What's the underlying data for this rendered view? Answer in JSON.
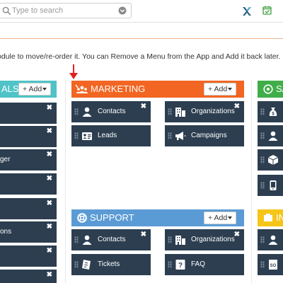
{
  "topbar": {
    "search_placeholder": "Type to search"
  },
  "instruction": "odule to move/re-order it. You can Remove a Menu from the App and Add it back later.",
  "add_label": "+ Add",
  "colors": {
    "tile_bg": "#2c3e50",
    "left_panel": "#4fc3c7",
    "marketing": "#f26522",
    "support": "#5b9bd5",
    "sales": "#3fae49",
    "inventory": "#f5c518"
  },
  "panels": {
    "left": {
      "title": "ALS",
      "tiles": [
        "",
        "",
        "ger",
        "",
        "",
        "ons",
        "",
        ""
      ]
    },
    "marketing": {
      "title": "MARKETING",
      "tiles": [
        {
          "label": "Contacts",
          "icon": "contacts-icon"
        },
        {
          "label": "Organizations",
          "icon": "organizations-icon"
        },
        {
          "label": "Leads",
          "icon": "leads-icon"
        },
        {
          "label": "Campaigns",
          "icon": "campaigns-icon"
        }
      ]
    },
    "support": {
      "title": "SUPPORT",
      "tiles": [
        {
          "label": "Contacts",
          "icon": "contacts-icon"
        },
        {
          "label": "Organizations",
          "icon": "organizations-icon"
        },
        {
          "label": "Tickets",
          "icon": "tickets-icon"
        },
        {
          "label": "FAQ",
          "icon": "faq-icon"
        }
      ]
    },
    "sales": {
      "title": "SA"
    },
    "inventory": {
      "title": "IN"
    }
  }
}
